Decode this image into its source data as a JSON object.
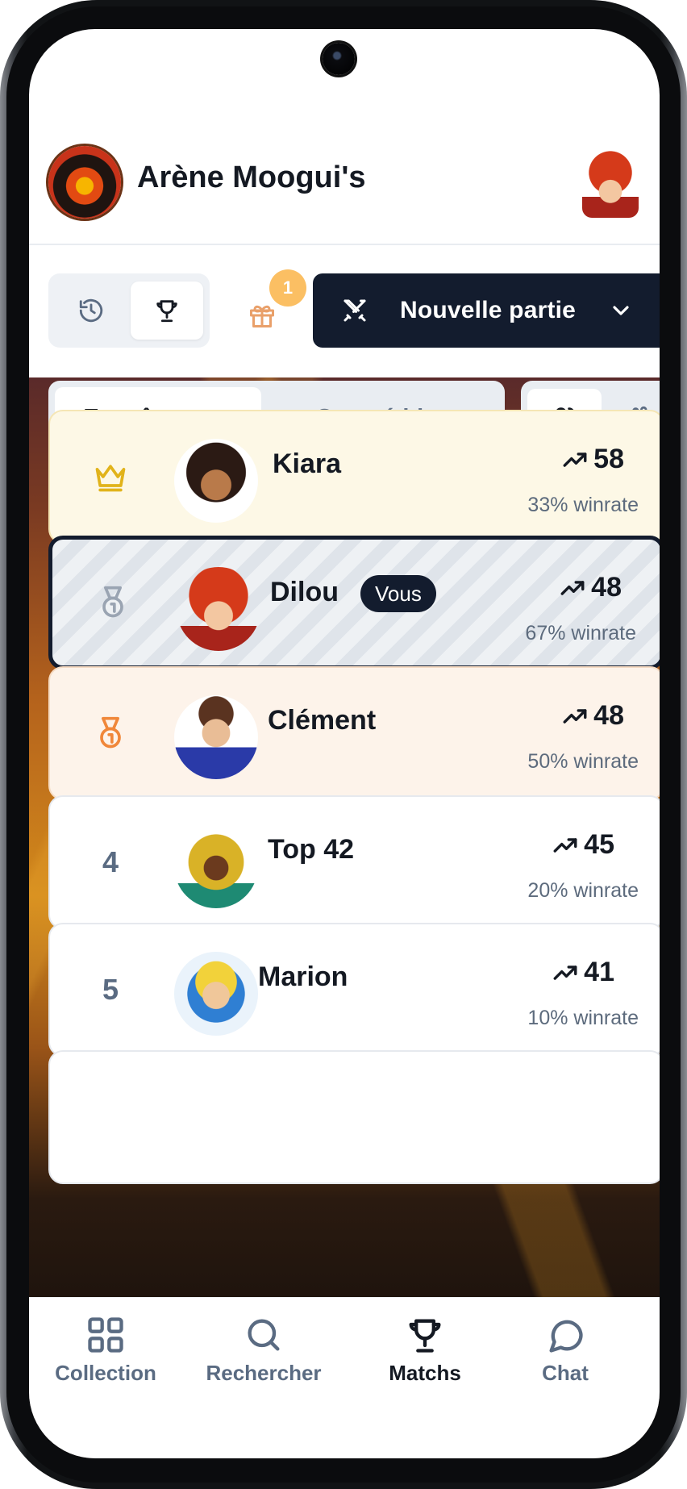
{
  "app": {
    "title": "Arène Moogui's"
  },
  "toolbar": {
    "gift_badge_count": "1",
    "new_game_label": "Nouvelle partie"
  },
  "mode_tabs": {
    "training": "Entraînement",
    "competition": "Compétition",
    "selected": "Entraînement"
  },
  "scope": {
    "selected": "friends"
  },
  "leaderboard": [
    {
      "rank_icon": "crown-icon",
      "name": "Kiara",
      "score": "58",
      "winrate": "33% winrate",
      "bg": "#fdf8e6"
    },
    {
      "rank_icon": "silver-medal-icon",
      "name": "Dilou",
      "you_badge": "Vous",
      "score": "48",
      "winrate": "67% winrate",
      "bg": "#eef1f4"
    },
    {
      "rank_icon": "bronze-medal-icon",
      "name": "Clément",
      "score": "48",
      "winrate": "50% winrate",
      "bg": "#fdf3ea"
    },
    {
      "rank": "4",
      "name": "Top 42",
      "score": "45",
      "winrate": "20% winrate",
      "bg": "#ffffff"
    },
    {
      "rank": "5",
      "name": "Marion",
      "score": "41",
      "winrate": "10% winrate",
      "bg": "#ffffff"
    }
  ],
  "bottom_nav": [
    {
      "label": "Collection",
      "icon": "grid-icon"
    },
    {
      "label": "Rechercher",
      "icon": "search-icon"
    },
    {
      "label": "Matchs",
      "icon": "trophy-icon",
      "active": true
    },
    {
      "label": "Chat",
      "icon": "chat-bubble-icon"
    }
  ],
  "colors": {
    "dark": "#131c2e",
    "gold": "#e1b31a",
    "silver": "#9aa4b2",
    "bronze": "#f0873a",
    "badge": "#fbbf63"
  }
}
